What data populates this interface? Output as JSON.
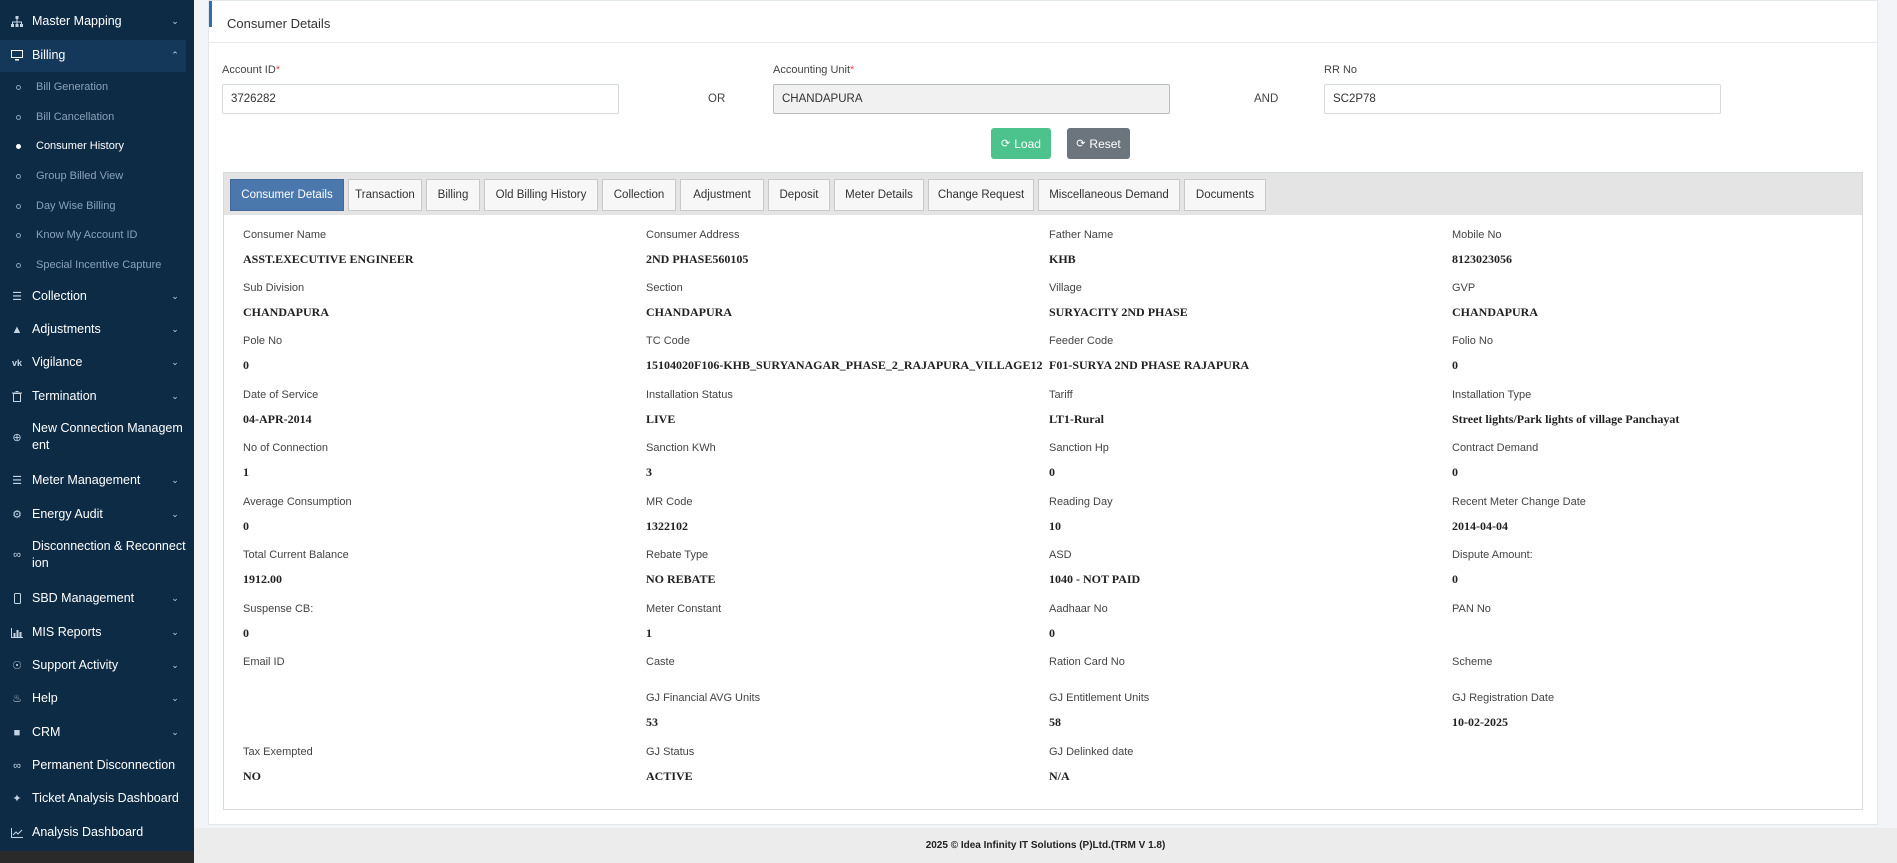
{
  "sidebar": {
    "items": [
      {
        "label": "Master Mapping",
        "icon": "sitemap-icon"
      },
      {
        "label": "Billing",
        "icon": "monitor-icon"
      },
      {
        "label": "Collection",
        "icon": "list-icon"
      },
      {
        "label": "Adjustments",
        "icon": "bank-icon"
      },
      {
        "label": "Vigilance",
        "icon": "vk-icon"
      },
      {
        "label": "Termination",
        "icon": "trash-icon"
      },
      {
        "label": "New Connection Management",
        "icon": "plus-circle-icon"
      },
      {
        "label": "Meter Management",
        "icon": "list-icon"
      },
      {
        "label": "Energy Audit",
        "icon": "cogs-icon"
      },
      {
        "label": "Disconnection & Reconnection",
        "icon": "chain-icon"
      },
      {
        "label": "SBD Management",
        "icon": "mobile-icon"
      },
      {
        "label": "MIS Reports",
        "icon": "bar-chart-icon"
      },
      {
        "label": "Support Activity",
        "icon": "headset-icon"
      },
      {
        "label": "Help",
        "icon": "help-icon"
      },
      {
        "label": "CRM",
        "icon": "crm-icon"
      },
      {
        "label": "Permanent Disconnection",
        "icon": "unlink-icon"
      },
      {
        "label": "Ticket Analysis Dashboard",
        "icon": "tag-icon"
      },
      {
        "label": "Analysis Dashboard",
        "icon": "line-chart-icon"
      }
    ],
    "billing_sub": [
      "Bill Generation",
      "Bill Cancellation",
      "Consumer History",
      "Group Billed View",
      "Day Wise Billing",
      "Know My Account ID",
      "Special Incentive Capture"
    ]
  },
  "header": {
    "title": "Consumer Details"
  },
  "form": {
    "account_label": "Account ID",
    "account_value": "3726282",
    "or_text": "OR",
    "unit_label": "Accounting Unit",
    "unit_value": "CHANDAPURA",
    "and_text": "AND",
    "rr_label": "RR No",
    "rr_value": "SC2P78",
    "required_mark": "*",
    "load_label": "Load",
    "reset_label": "Reset"
  },
  "tabs": [
    "Consumer Details",
    "Transaction",
    "Billing",
    "Old Billing History",
    "Collection",
    "Adjustment",
    "Deposit",
    "Meter Details",
    "Change Request",
    "Miscellaneous Demand",
    "Documents"
  ],
  "details": [
    {
      "label": "Consumer Name",
      "value": "ASST.EXECUTIVE ENGINEER"
    },
    {
      "label": "Consumer Address",
      "value": "2ND PHASE560105"
    },
    {
      "label": "Father Name",
      "value": "KHB"
    },
    {
      "label": "Mobile No",
      "value": "8123023056"
    },
    {
      "label": "Sub Division",
      "value": "CHANDAPURA"
    },
    {
      "label": "Section",
      "value": "CHANDAPURA"
    },
    {
      "label": "Village",
      "value": "SURYACITY 2ND PHASE"
    },
    {
      "label": "GVP",
      "value": "CHANDAPURA"
    },
    {
      "label": "Pole No",
      "value": "0"
    },
    {
      "label": "TC Code",
      "value": "15104020F106-KHB_SURYANAGAR_PHASE_2_RAJAPURA_VILLAGE12"
    },
    {
      "label": "Feeder Code",
      "value": "F01-SURYA 2ND PHASE RAJAPURA"
    },
    {
      "label": "Folio No",
      "value": "0"
    },
    {
      "label": "Date of Service",
      "value": "04-APR-2014"
    },
    {
      "label": "Installation Status",
      "value": "LIVE"
    },
    {
      "label": "Tariff",
      "value": "LT1-Rural"
    },
    {
      "label": "Installation Type",
      "value": "Street lights/Park lights of village Panchayat"
    },
    {
      "label": "No of Connection",
      "value": "1"
    },
    {
      "label": "Sanction KWh",
      "value": "3"
    },
    {
      "label": "Sanction Hp",
      "value": "0"
    },
    {
      "label": "Contract Demand",
      "value": "0"
    },
    {
      "label": "Average Consumption",
      "value": "0"
    },
    {
      "label": "MR Code",
      "value": "1322102"
    },
    {
      "label": "Reading Day",
      "value": "10"
    },
    {
      "label": "Recent Meter Change Date",
      "value": "2014-04-04"
    },
    {
      "label": "Total Current Balance",
      "value": "1912.00"
    },
    {
      "label": "Rebate Type",
      "value": "NO REBATE"
    },
    {
      "label": "ASD",
      "value": "1040 - NOT PAID"
    },
    {
      "label": "Dispute Amount:",
      "value": "0"
    },
    {
      "label": "Suspense CB:",
      "value": "0"
    },
    {
      "label": "Meter Constant",
      "value": "1"
    },
    {
      "label": "Aadhaar No",
      "value": "0"
    },
    {
      "label": "PAN No",
      "value": ""
    },
    {
      "label": "Email ID",
      "value": ""
    },
    {
      "label": "Caste",
      "value": ""
    },
    {
      "label": "Ration Card No",
      "value": ""
    },
    {
      "label": "Scheme",
      "value": ""
    },
    {
      "label": "GJ Financial AVG Units",
      "value": "53"
    },
    {
      "label": "GJ Entitlement Units",
      "value": "58"
    },
    {
      "label": "GJ Registration Date",
      "value": "10-02-2025"
    },
    {
      "label": "Tax Exempted",
      "value": "NO"
    },
    {
      "label": "GJ Status",
      "value": "ACTIVE"
    },
    {
      "label": "GJ Delinked date",
      "value": "N/A"
    }
  ],
  "footer": {
    "text": "2025 © Idea Infinity IT Solutions (P)Ltd.(TRM V 1.8)"
  }
}
